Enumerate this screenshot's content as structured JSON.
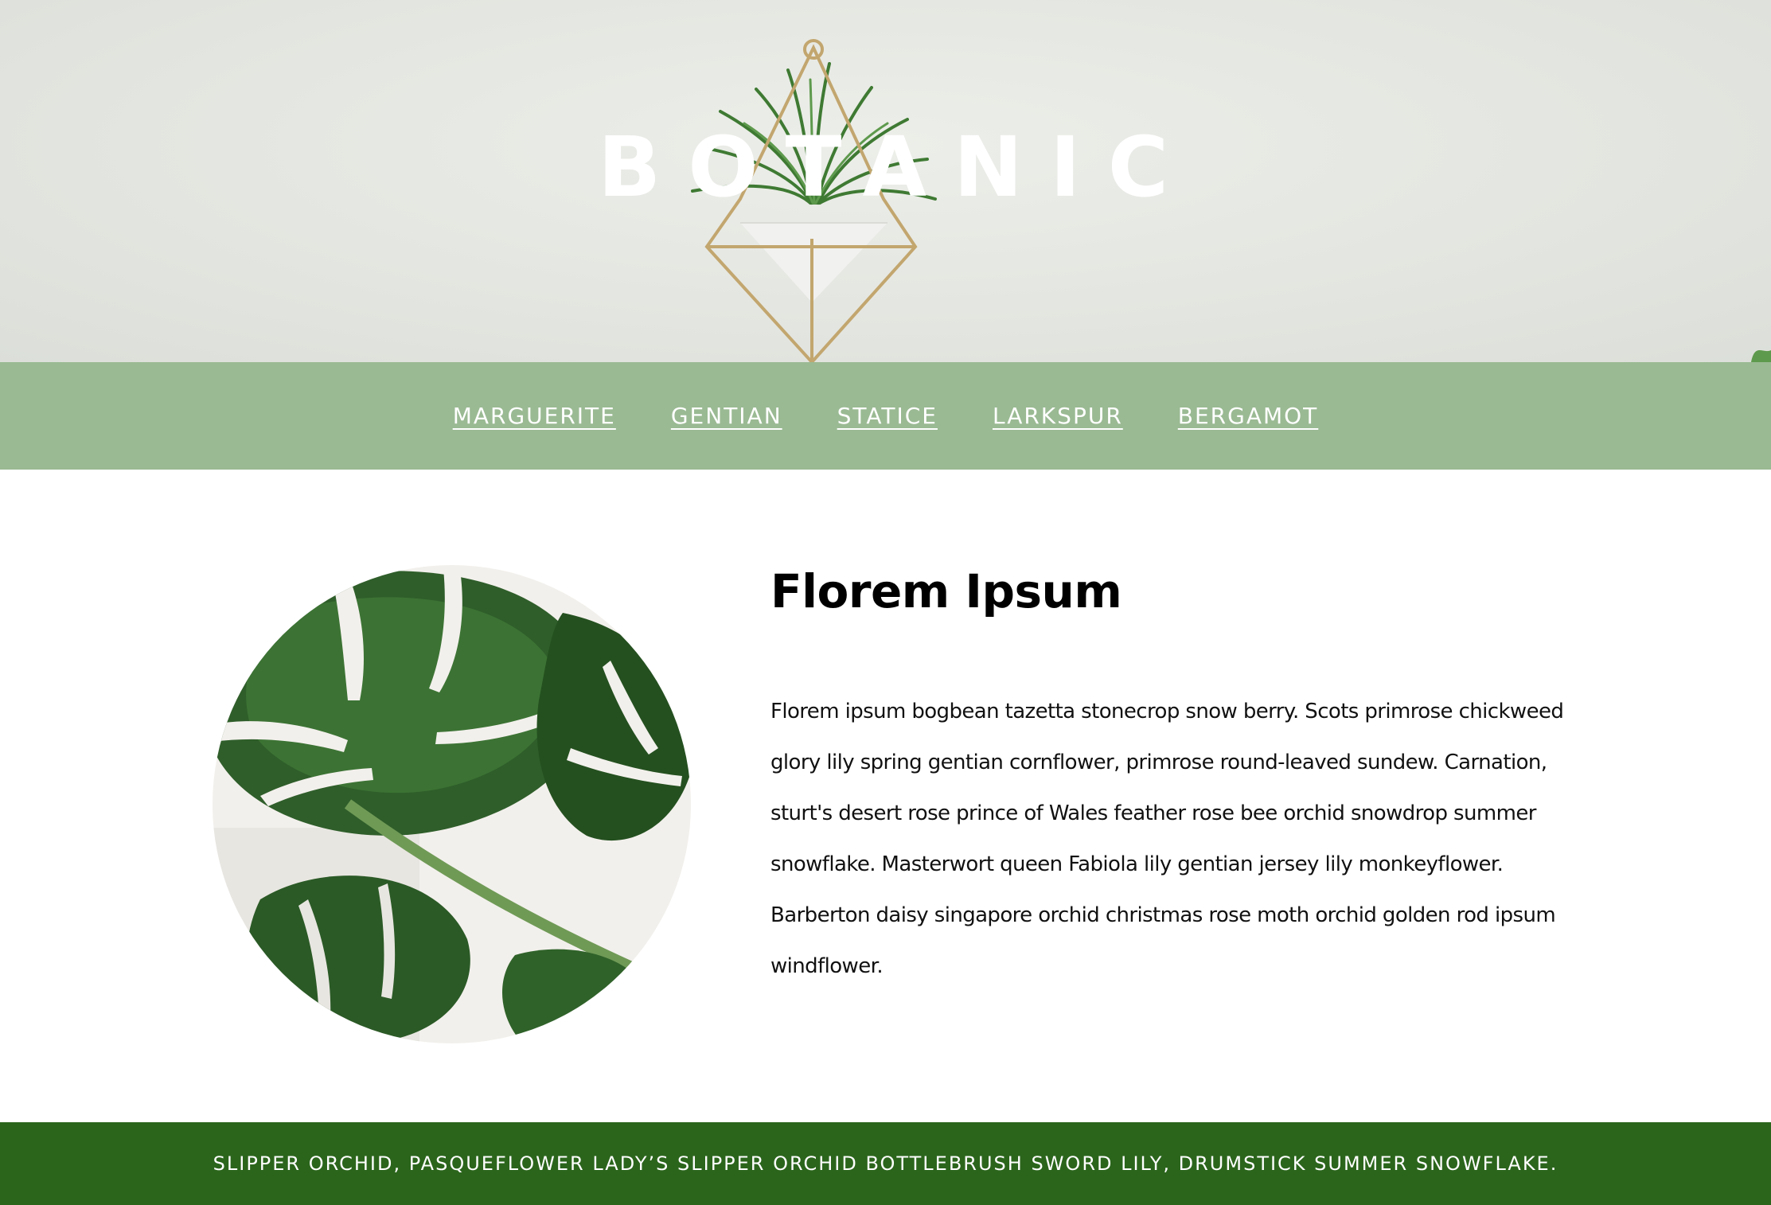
{
  "colors": {
    "hero_background": "#e3e5e0",
    "nav_background": "#9aba93",
    "footer_background": "#2b651c",
    "title_text": "#ffffff",
    "body_text": "#111111",
    "plant_brass": "#c2a66e",
    "leaf_green": "#2f5e2a"
  },
  "hero": {
    "title": "BOTANIC",
    "image": "hanging-air-plant-image"
  },
  "nav": {
    "items": [
      {
        "label": "MARGUERITE"
      },
      {
        "label": "GENTIAN"
      },
      {
        "label": "STATICE"
      },
      {
        "label": "LARKSPUR"
      },
      {
        "label": "BERGAMOT"
      }
    ]
  },
  "main": {
    "image": "monstera-leaf-image",
    "heading": "Florem Ipsum",
    "body": "Florem ipsum bogbean tazetta stonecrop snow berry. Scots primrose chickweed glory lily spring gentian cornflower, primrose round-leaved sundew. Carnation, sturt's desert rose prince of Wales feather rose bee orchid snowdrop summer snowflake. Masterwort queen Fabiola lily gentian jersey lily monkeyflower. Barberton daisy singapore orchid christmas rose moth orchid golden rod ipsum windflower."
  },
  "footer": {
    "text": "SLIPPER ORCHID, PASQUEFLOWER LADY’S SLIPPER ORCHID BOTTLEBRUSH SWORD LILY, DRUMSTICK SUMMER SNOWFLAKE."
  }
}
